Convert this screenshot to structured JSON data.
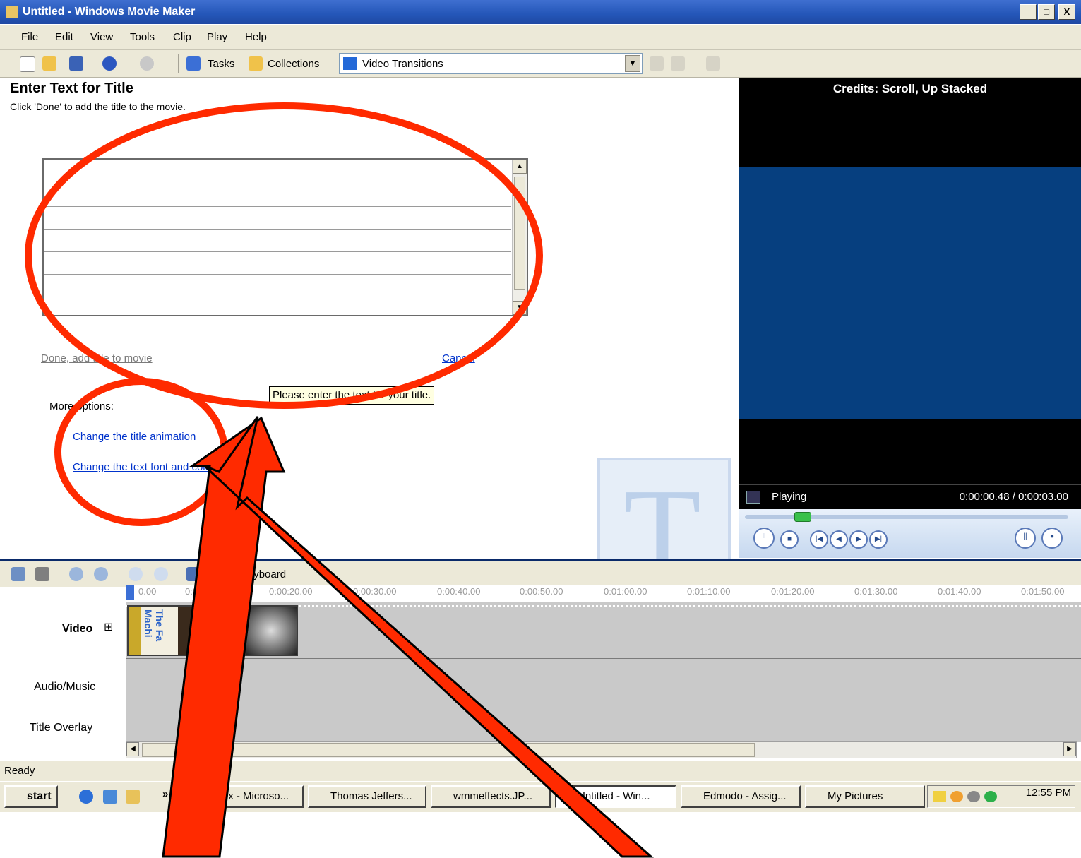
{
  "window": {
    "title": "Untitled - Windows Movie Maker",
    "min": "_",
    "max": "□",
    "close": "X"
  },
  "menu": [
    "File",
    "Edit",
    "View",
    "Tools",
    "Clip",
    "Play",
    "Help"
  ],
  "toolbar": {
    "tasks_label": "Tasks",
    "collections_label": "Collections",
    "combo_value": "Video Transitions",
    "combo_arrow": "▼"
  },
  "task_pane": {
    "heading": "Enter Text for Title",
    "subheading": "Click 'Done' to add the title to the movie.",
    "done_link": "Done, add title to movie",
    "cancel_link": "Cancel",
    "more_options": "More options:",
    "link_animation": "Change the title animation",
    "link_font": "Change the text font and color",
    "tooltip": "Please enter the text for your title."
  },
  "preview": {
    "title": "Credits: Scroll, Up Stacked",
    "status": "Playing",
    "time": "0:00:00.48 / 0:00:03.00"
  },
  "timeline": {
    "storyboard_label": "Show Storyboard",
    "ticks": [
      "0.00",
      "0:00:10.00",
      "0:00:20.00",
      "0:00:30.00",
      "0:00:40.00",
      "0:00:50.00",
      "0:01:00.00",
      "0:01:10.00",
      "0:01:20.00",
      "0:01:30.00",
      "0:01:40.00",
      "0:01:50.00"
    ],
    "tracks": {
      "video": "Video",
      "audio": "Audio/Music",
      "overlay": "Title Overlay"
    },
    "expand_glyph": "⊞",
    "clip_text": "The Fa Machi"
  },
  "status_bar": "Ready",
  "taskbar": {
    "start": "start",
    "chevron": "»",
    "buttons": [
      "Inbox - Microso...",
      "Thomas Jeffers...",
      "wmmeffects.JP...",
      "Untitled - Win...",
      "Edmodo - Assig...",
      "My Pictures"
    ],
    "clock": "12:55 PM"
  },
  "colors": {
    "annotation_red": "#ff2a00",
    "preview_blue": "#063f7f",
    "link_blue": "#0033cc"
  }
}
